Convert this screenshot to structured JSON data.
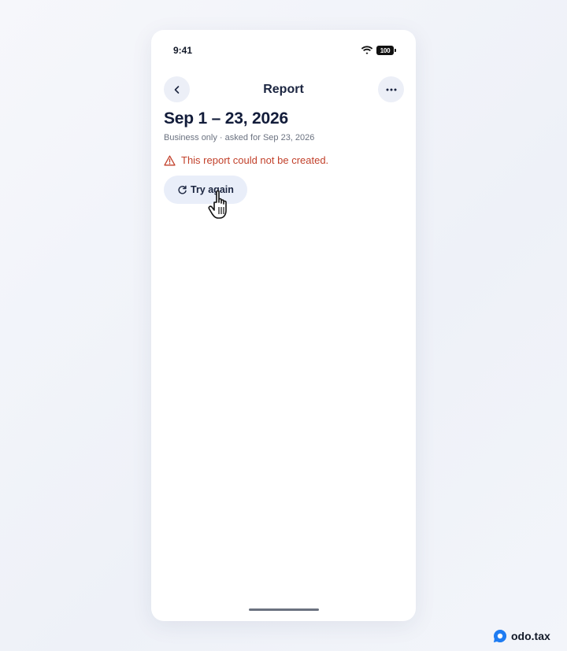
{
  "status_bar": {
    "time": "9:41",
    "battery": "100"
  },
  "nav": {
    "title": "Report",
    "back_icon": "chevron-left-icon",
    "more_icon": "ellipsis-icon"
  },
  "report": {
    "title": "Sep 1 – 23, 2026",
    "subtitle": "Business only · asked for Sep 23, 2026",
    "error": "This report could not be created.",
    "retry_label": "Try again"
  },
  "brand": {
    "name": "odo.tax"
  },
  "colors": {
    "error": "#c2412b",
    "button_bg": "#e9eef9",
    "title": "#121c3a",
    "brand_blue": "#1f7cf2"
  }
}
